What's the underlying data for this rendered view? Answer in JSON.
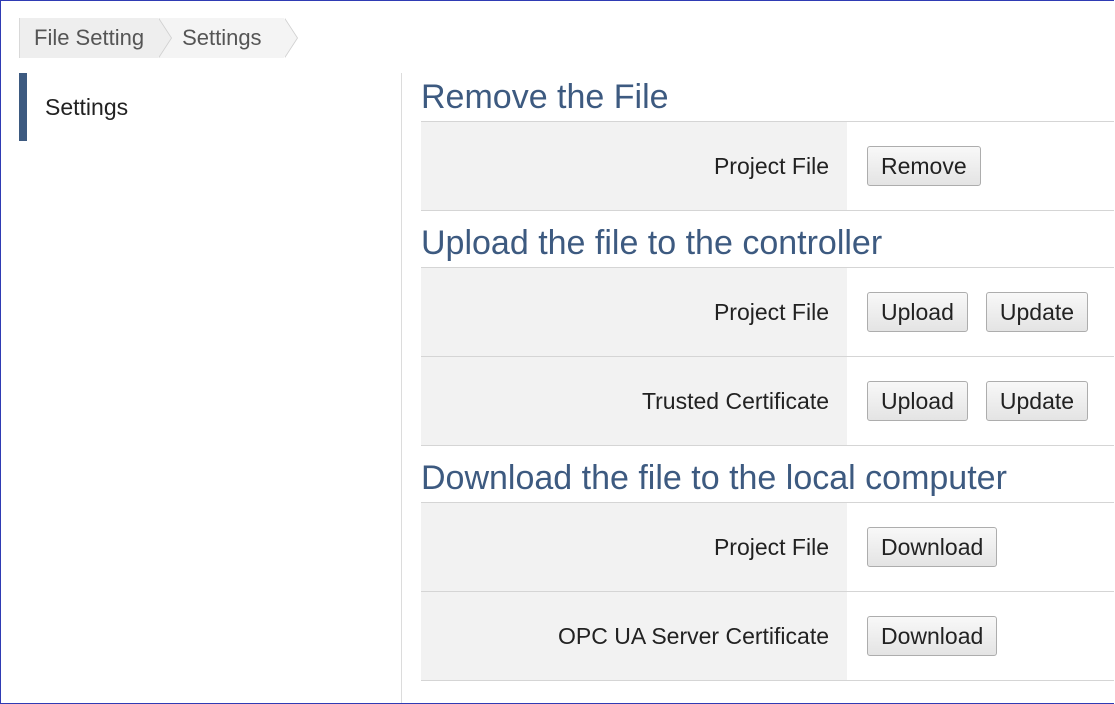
{
  "breadcrumb": {
    "items": [
      "File Setting",
      "Settings"
    ]
  },
  "sidebar": {
    "items": [
      {
        "label": "Settings",
        "active": true
      }
    ],
    "accent_color": "#3d5a80"
  },
  "sections": [
    {
      "title": "Remove the File",
      "rows": [
        {
          "label": "Project File",
          "buttons": [
            "Remove"
          ]
        }
      ]
    },
    {
      "title": "Upload the file to the controller",
      "rows": [
        {
          "label": "Project File",
          "buttons": [
            "Upload",
            "Update"
          ]
        },
        {
          "label": "Trusted Certificate",
          "buttons": [
            "Upload",
            "Update"
          ]
        }
      ]
    },
    {
      "title": "Download the file to the local computer",
      "rows": [
        {
          "label": "Project File",
          "buttons": [
            "Download"
          ]
        },
        {
          "label": "OPC UA Server Certificate",
          "buttons": [
            "Download"
          ]
        }
      ]
    }
  ]
}
